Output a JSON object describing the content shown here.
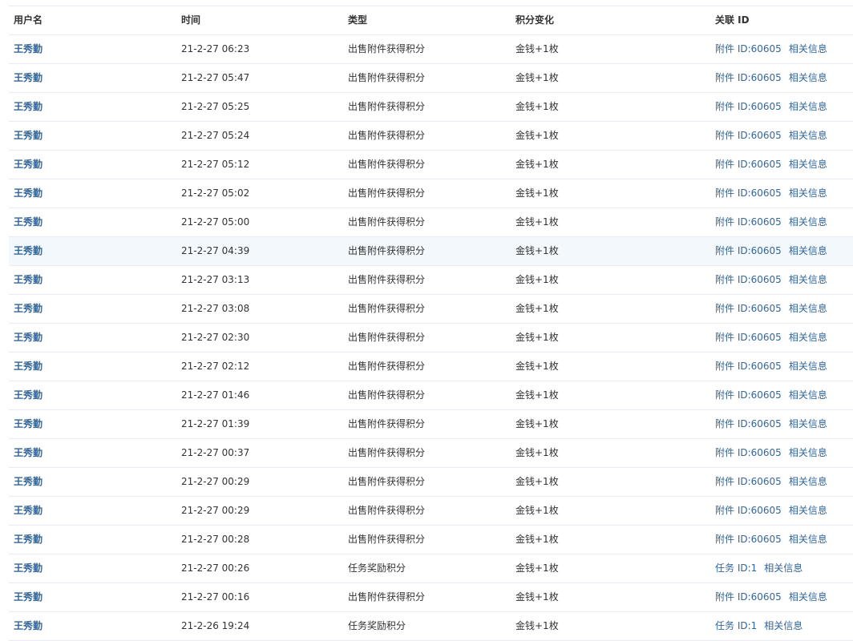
{
  "table": {
    "headers": {
      "user": "用户名",
      "time": "时间",
      "type": "类型",
      "change": "积分变化",
      "related": "关联 ID"
    },
    "rows": [
      {
        "user": "王秀勤",
        "time": "21-2-27 06:23",
        "type": "出售附件获得积分",
        "change": "金钱+1枚",
        "ref": "附件 ID:60605",
        "info": "相关信息"
      },
      {
        "user": "王秀勤",
        "time": "21-2-27 05:47",
        "type": "出售附件获得积分",
        "change": "金钱+1枚",
        "ref": "附件 ID:60605",
        "info": "相关信息"
      },
      {
        "user": "王秀勤",
        "time": "21-2-27 05:25",
        "type": "出售附件获得积分",
        "change": "金钱+1枚",
        "ref": "附件 ID:60605",
        "info": "相关信息"
      },
      {
        "user": "王秀勤",
        "time": "21-2-27 05:24",
        "type": "出售附件获得积分",
        "change": "金钱+1枚",
        "ref": "附件 ID:60605",
        "info": "相关信息"
      },
      {
        "user": "王秀勤",
        "time": "21-2-27 05:12",
        "type": "出售附件获得积分",
        "change": "金钱+1枚",
        "ref": "附件 ID:60605",
        "info": "相关信息"
      },
      {
        "user": "王秀勤",
        "time": "21-2-27 05:02",
        "type": "出售附件获得积分",
        "change": "金钱+1枚",
        "ref": "附件 ID:60605",
        "info": "相关信息"
      },
      {
        "user": "王秀勤",
        "time": "21-2-27 05:00",
        "type": "出售附件获得积分",
        "change": "金钱+1枚",
        "ref": "附件 ID:60605",
        "info": "相关信息"
      },
      {
        "user": "王秀勤",
        "time": "21-2-27 04:39",
        "type": "出售附件获得积分",
        "change": "金钱+1枚",
        "ref": "附件 ID:60605",
        "info": "相关信息"
      },
      {
        "user": "王秀勤",
        "time": "21-2-27 03:13",
        "type": "出售附件获得积分",
        "change": "金钱+1枚",
        "ref": "附件 ID:60605",
        "info": "相关信息"
      },
      {
        "user": "王秀勤",
        "time": "21-2-27 03:08",
        "type": "出售附件获得积分",
        "change": "金钱+1枚",
        "ref": "附件 ID:60605",
        "info": "相关信息"
      },
      {
        "user": "王秀勤",
        "time": "21-2-27 02:30",
        "type": "出售附件获得积分",
        "change": "金钱+1枚",
        "ref": "附件 ID:60605",
        "info": "相关信息"
      },
      {
        "user": "王秀勤",
        "time": "21-2-27 02:12",
        "type": "出售附件获得积分",
        "change": "金钱+1枚",
        "ref": "附件 ID:60605",
        "info": "相关信息"
      },
      {
        "user": "王秀勤",
        "time": "21-2-27 01:46",
        "type": "出售附件获得积分",
        "change": "金钱+1枚",
        "ref": "附件 ID:60605",
        "info": "相关信息"
      },
      {
        "user": "王秀勤",
        "time": "21-2-27 01:39",
        "type": "出售附件获得积分",
        "change": "金钱+1枚",
        "ref": "附件 ID:60605",
        "info": "相关信息"
      },
      {
        "user": "王秀勤",
        "time": "21-2-27 00:37",
        "type": "出售附件获得积分",
        "change": "金钱+1枚",
        "ref": "附件 ID:60605",
        "info": "相关信息"
      },
      {
        "user": "王秀勤",
        "time": "21-2-27 00:29",
        "type": "出售附件获得积分",
        "change": "金钱+1枚",
        "ref": "附件 ID:60605",
        "info": "相关信息"
      },
      {
        "user": "王秀勤",
        "time": "21-2-27 00:29",
        "type": "出售附件获得积分",
        "change": "金钱+1枚",
        "ref": "附件 ID:60605",
        "info": "相关信息"
      },
      {
        "user": "王秀勤",
        "time": "21-2-27 00:28",
        "type": "出售附件获得积分",
        "change": "金钱+1枚",
        "ref": "附件 ID:60605",
        "info": "相关信息"
      },
      {
        "user": "王秀勤",
        "time": "21-2-27 00:26",
        "type": "任务奖励积分",
        "change": "金钱+1枚",
        "ref": "任务 ID:1",
        "info": "相关信息"
      },
      {
        "user": "王秀勤",
        "time": "21-2-27 00:16",
        "type": "出售附件获得积分",
        "change": "金钱+1枚",
        "ref": "附件 ID:60605",
        "info": "相关信息"
      },
      {
        "user": "王秀勤",
        "time": "21-2-26 19:24",
        "type": "任务奖励积分",
        "change": "金钱+1枚",
        "ref": "任务 ID:1",
        "info": "相关信息"
      }
    ],
    "highlighted_row_index": 7
  },
  "colors": {
    "link": "#336699",
    "border": "#e6ecf1",
    "highlight": "#f2f8fc",
    "text": "#333333"
  }
}
